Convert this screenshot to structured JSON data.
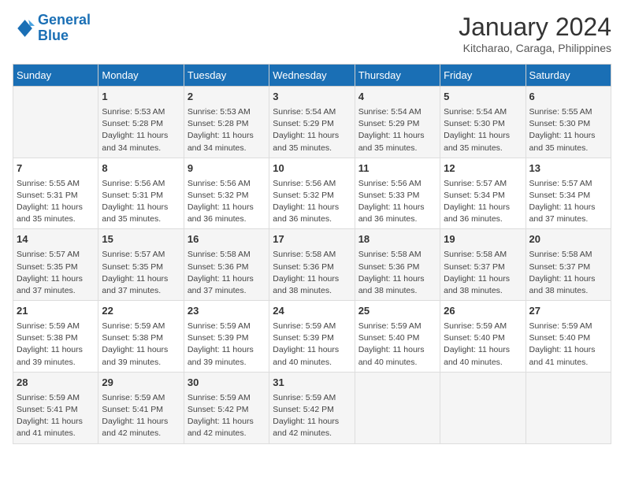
{
  "logo": {
    "line1": "General",
    "line2": "Blue"
  },
  "title": "January 2024",
  "subtitle": "Kitcharao, Caraga, Philippines",
  "days_header": [
    "Sunday",
    "Monday",
    "Tuesday",
    "Wednesday",
    "Thursday",
    "Friday",
    "Saturday"
  ],
  "weeks": [
    [
      {
        "day": "",
        "info": ""
      },
      {
        "day": "1",
        "info": "Sunrise: 5:53 AM\nSunset: 5:28 PM\nDaylight: 11 hours\nand 34 minutes."
      },
      {
        "day": "2",
        "info": "Sunrise: 5:53 AM\nSunset: 5:28 PM\nDaylight: 11 hours\nand 34 minutes."
      },
      {
        "day": "3",
        "info": "Sunrise: 5:54 AM\nSunset: 5:29 PM\nDaylight: 11 hours\nand 35 minutes."
      },
      {
        "day": "4",
        "info": "Sunrise: 5:54 AM\nSunset: 5:29 PM\nDaylight: 11 hours\nand 35 minutes."
      },
      {
        "day": "5",
        "info": "Sunrise: 5:54 AM\nSunset: 5:30 PM\nDaylight: 11 hours\nand 35 minutes."
      },
      {
        "day": "6",
        "info": "Sunrise: 5:55 AM\nSunset: 5:30 PM\nDaylight: 11 hours\nand 35 minutes."
      }
    ],
    [
      {
        "day": "7",
        "info": "Sunrise: 5:55 AM\nSunset: 5:31 PM\nDaylight: 11 hours\nand 35 minutes."
      },
      {
        "day": "8",
        "info": "Sunrise: 5:56 AM\nSunset: 5:31 PM\nDaylight: 11 hours\nand 35 minutes."
      },
      {
        "day": "9",
        "info": "Sunrise: 5:56 AM\nSunset: 5:32 PM\nDaylight: 11 hours\nand 36 minutes."
      },
      {
        "day": "10",
        "info": "Sunrise: 5:56 AM\nSunset: 5:32 PM\nDaylight: 11 hours\nand 36 minutes."
      },
      {
        "day": "11",
        "info": "Sunrise: 5:56 AM\nSunset: 5:33 PM\nDaylight: 11 hours\nand 36 minutes."
      },
      {
        "day": "12",
        "info": "Sunrise: 5:57 AM\nSunset: 5:34 PM\nDaylight: 11 hours\nand 36 minutes."
      },
      {
        "day": "13",
        "info": "Sunrise: 5:57 AM\nSunset: 5:34 PM\nDaylight: 11 hours\nand 37 minutes."
      }
    ],
    [
      {
        "day": "14",
        "info": "Sunrise: 5:57 AM\nSunset: 5:35 PM\nDaylight: 11 hours\nand 37 minutes."
      },
      {
        "day": "15",
        "info": "Sunrise: 5:57 AM\nSunset: 5:35 PM\nDaylight: 11 hours\nand 37 minutes."
      },
      {
        "day": "16",
        "info": "Sunrise: 5:58 AM\nSunset: 5:36 PM\nDaylight: 11 hours\nand 37 minutes."
      },
      {
        "day": "17",
        "info": "Sunrise: 5:58 AM\nSunset: 5:36 PM\nDaylight: 11 hours\nand 38 minutes."
      },
      {
        "day": "18",
        "info": "Sunrise: 5:58 AM\nSunset: 5:36 PM\nDaylight: 11 hours\nand 38 minutes."
      },
      {
        "day": "19",
        "info": "Sunrise: 5:58 AM\nSunset: 5:37 PM\nDaylight: 11 hours\nand 38 minutes."
      },
      {
        "day": "20",
        "info": "Sunrise: 5:58 AM\nSunset: 5:37 PM\nDaylight: 11 hours\nand 38 minutes."
      }
    ],
    [
      {
        "day": "21",
        "info": "Sunrise: 5:59 AM\nSunset: 5:38 PM\nDaylight: 11 hours\nand 39 minutes."
      },
      {
        "day": "22",
        "info": "Sunrise: 5:59 AM\nSunset: 5:38 PM\nDaylight: 11 hours\nand 39 minutes."
      },
      {
        "day": "23",
        "info": "Sunrise: 5:59 AM\nSunset: 5:39 PM\nDaylight: 11 hours\nand 39 minutes."
      },
      {
        "day": "24",
        "info": "Sunrise: 5:59 AM\nSunset: 5:39 PM\nDaylight: 11 hours\nand 40 minutes."
      },
      {
        "day": "25",
        "info": "Sunrise: 5:59 AM\nSunset: 5:40 PM\nDaylight: 11 hours\nand 40 minutes."
      },
      {
        "day": "26",
        "info": "Sunrise: 5:59 AM\nSunset: 5:40 PM\nDaylight: 11 hours\nand 40 minutes."
      },
      {
        "day": "27",
        "info": "Sunrise: 5:59 AM\nSunset: 5:40 PM\nDaylight: 11 hours\nand 41 minutes."
      }
    ],
    [
      {
        "day": "28",
        "info": "Sunrise: 5:59 AM\nSunset: 5:41 PM\nDaylight: 11 hours\nand 41 minutes."
      },
      {
        "day": "29",
        "info": "Sunrise: 5:59 AM\nSunset: 5:41 PM\nDaylight: 11 hours\nand 42 minutes."
      },
      {
        "day": "30",
        "info": "Sunrise: 5:59 AM\nSunset: 5:42 PM\nDaylight: 11 hours\nand 42 minutes."
      },
      {
        "day": "31",
        "info": "Sunrise: 5:59 AM\nSunset: 5:42 PM\nDaylight: 11 hours\nand 42 minutes."
      },
      {
        "day": "",
        "info": ""
      },
      {
        "day": "",
        "info": ""
      },
      {
        "day": "",
        "info": ""
      }
    ]
  ]
}
